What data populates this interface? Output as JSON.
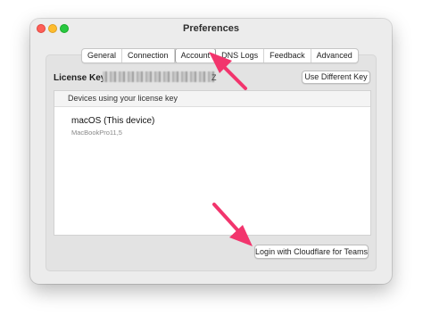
{
  "window": {
    "title": "Preferences"
  },
  "tabs": [
    {
      "label": "General",
      "active": false
    },
    {
      "label": "Connection",
      "active": false
    },
    {
      "label": "Account",
      "active": true
    },
    {
      "label": "DNS Logs",
      "active": false
    },
    {
      "label": "Feedback",
      "active": false
    },
    {
      "label": "Advanced",
      "active": false
    }
  ],
  "account": {
    "license_label": "License Key:",
    "license_visible_suffix": "Z",
    "use_different_key_label": "Use Different Key",
    "devices_header": "Devices using your license key",
    "device": {
      "name": "macOS (This device)",
      "model": "MacBookPro11,5"
    },
    "login_teams_label": "Login with Cloudflare for Teams"
  },
  "colors": {
    "annotation_arrow": "#f2356d",
    "close": "#fe5f57",
    "minimize": "#febc2e",
    "maximize": "#28c840"
  }
}
